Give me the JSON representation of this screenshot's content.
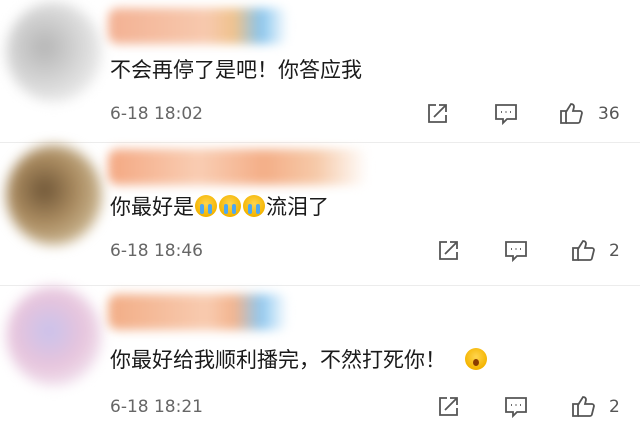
{
  "comments": [
    {
      "text": "不会再停了是吧！你答应我",
      "time": "6-18 18:02",
      "likes": "36",
      "avatar_colors": [
        "#d9d9d9",
        "#9f9f9f"
      ],
      "username_colors": [
        "#f1a98a",
        "#f6c0a3",
        "#7ec1ec"
      ],
      "emojis": []
    },
    {
      "text_before": "你最好是",
      "text_after": "流泪了",
      "time": "6-18 18:46",
      "likes": "2",
      "avatar_colors": [
        "#b89969",
        "#6f5637"
      ],
      "username_colors": [
        "#f4a882",
        "#f8c5aa",
        "#f0b07e"
      ],
      "emojis": [
        "crying-face",
        "crying-face",
        "crying-face"
      ]
    },
    {
      "text": "你最好给我顺利播完，不然打死你！",
      "time": "6-18 18:21",
      "likes": "2",
      "avatar_colors": [
        "#eac7df",
        "#c9c2ec"
      ],
      "username_colors": [
        "#f2ad86",
        "#f6c7a6",
        "#8fc8f0"
      ],
      "emojis": [
        "shocked-face"
      ]
    }
  ],
  "icons": {
    "share": "share-icon",
    "reply": "comment-icon",
    "like": "thumbs-up-icon"
  }
}
